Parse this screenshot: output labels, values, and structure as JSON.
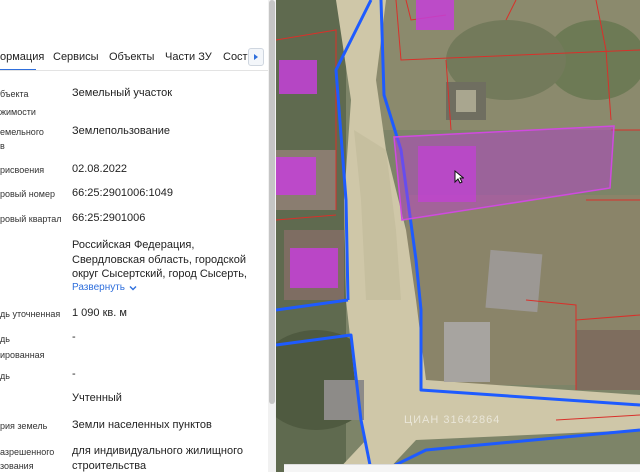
{
  "tabs": [
    {
      "label": "ормация",
      "active": true
    },
    {
      "label": "Сервисы",
      "active": false
    },
    {
      "label": "Объекты",
      "active": false
    },
    {
      "label": "Части ЗУ",
      "active": false
    },
    {
      "label": "Соста",
      "active": false
    }
  ],
  "tab_scroll_icon": "chevron-right-icon",
  "rows": [
    {
      "label_lines": [
        "бъекта",
        "жимости"
      ],
      "value_lines": [
        "Земельный участок"
      ]
    },
    {
      "label_lines": [
        "емельного",
        "в"
      ],
      "value_lines": [
        "Землепользование"
      ]
    },
    {
      "label_lines": [
        "рисвоения"
      ],
      "value_lines": [
        "02.08.2022"
      ]
    },
    {
      "label_lines": [
        "ровый номер"
      ],
      "value_lines": [
        "66:25:2901006:1049"
      ]
    },
    {
      "label_lines": [
        "ровый квартал"
      ],
      "value_lines": [
        "66:25:2901006"
      ]
    },
    {
      "label_lines": [
        ""
      ],
      "value_lines": [
        "Российская Федерация,",
        "Свердловская область, городской",
        "округ Сысертский, город Сысерть,"
      ]
    },
    {
      "label_lines": [
        "дь уточненная"
      ],
      "value_lines": [
        "1 090 кв. м"
      ]
    },
    {
      "label_lines": [
        "дь",
        "ированная"
      ],
      "value_lines": [
        "-"
      ]
    },
    {
      "label_lines": [
        "дь"
      ],
      "value_lines": [
        "-"
      ]
    },
    {
      "label_lines": [
        ""
      ],
      "value_lines": [
        "Учтенный"
      ]
    },
    {
      "label_lines": [
        "рия земель"
      ],
      "value_lines": [
        "Земли населенных пунктов"
      ]
    },
    {
      "label_lines": [
        "азрешенного",
        "зования"
      ],
      "value_lines": [
        "для индивидуального жилищного",
        "строительства"
      ]
    }
  ],
  "expand": {
    "label": "Развернуть",
    "icon": "chevron-down-icon"
  },
  "map": {
    "watermark": "ЦИАН 31642864",
    "colors": {
      "boundary": "#1e5bff",
      "cadastre_line": "#d9302a",
      "highlight_fill": "#c23bd6",
      "building_fill": "#c43fd8",
      "road": "#cfc7a8"
    }
  },
  "accent": "#2f6fdc"
}
